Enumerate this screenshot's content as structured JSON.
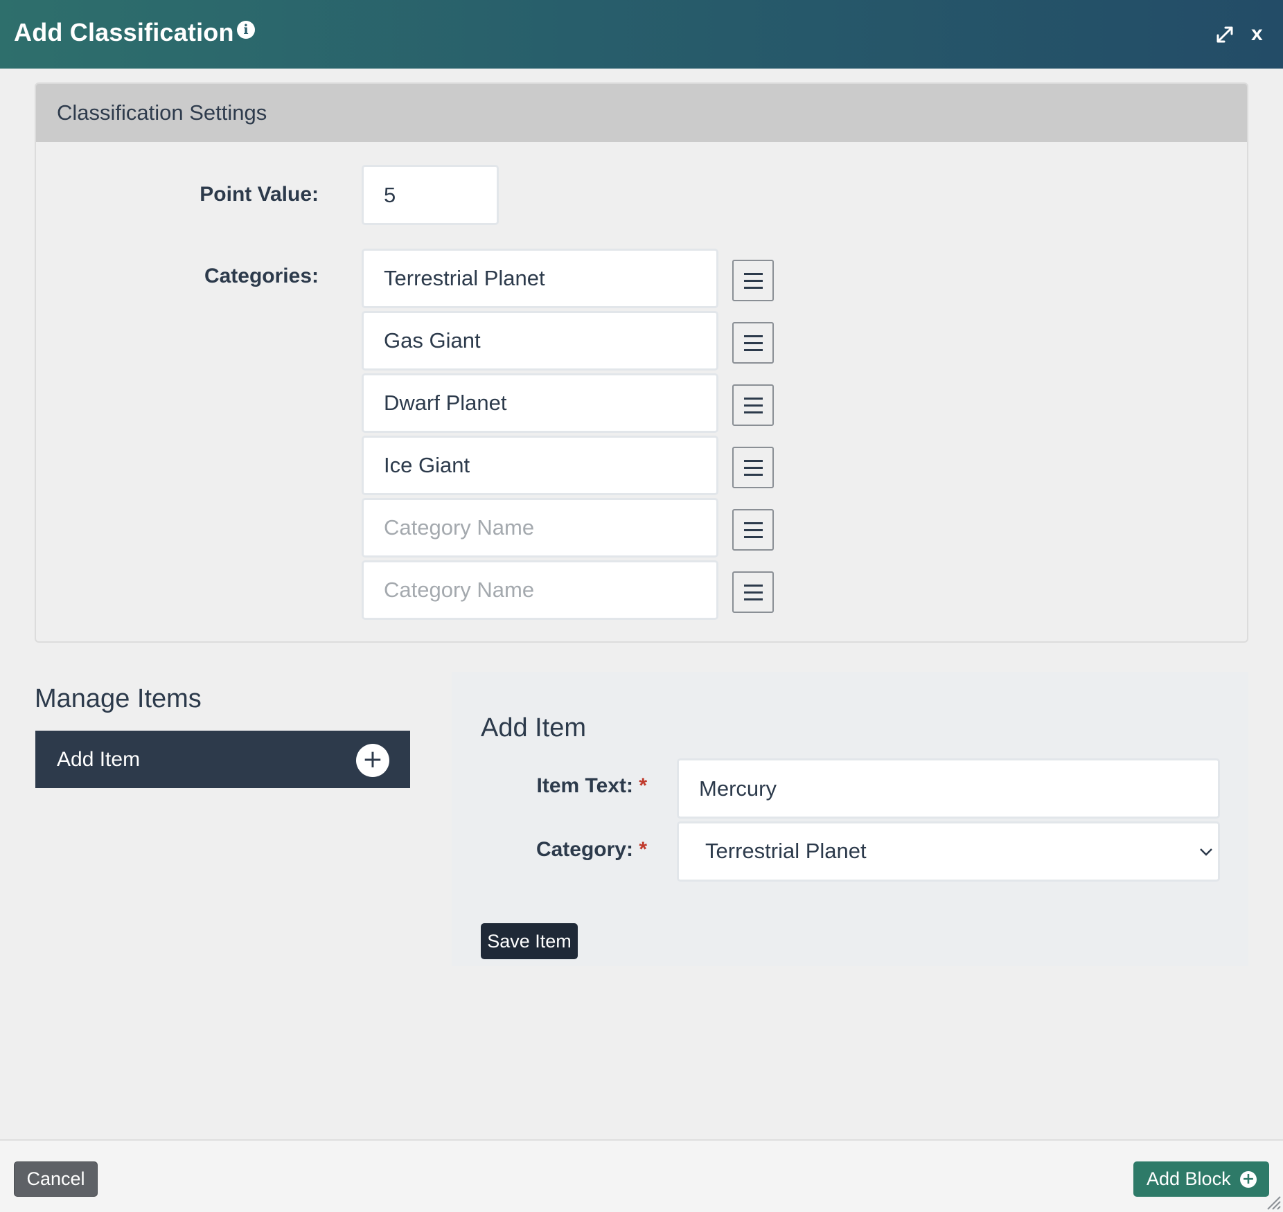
{
  "modal": {
    "title": "Add Classification",
    "info_icon": "info-icon",
    "expand_icon": "expand-icon",
    "close_label": "x"
  },
  "settings": {
    "heading": "Classification Settings",
    "point_value_label": "Point Value:",
    "point_value": "5",
    "categories_label": "Categories:",
    "categories": [
      {
        "value": "Terrestrial Planet",
        "placeholder": "Category Name"
      },
      {
        "value": "Gas Giant",
        "placeholder": "Category Name"
      },
      {
        "value": "Dwarf Planet",
        "placeholder": "Category Name"
      },
      {
        "value": "Ice Giant",
        "placeholder": "Category Name"
      },
      {
        "value": "",
        "placeholder": "Category Name"
      },
      {
        "value": "",
        "placeholder": "Category Name"
      }
    ],
    "drag_icon": "hamburger-icon"
  },
  "manage": {
    "heading": "Manage Items",
    "add_item_label": "Add Item",
    "plus_symbol": "+"
  },
  "item_form": {
    "heading": "Add Item",
    "item_text_label": "Item Text:",
    "item_text_value": "Mercury",
    "category_label": "Category:",
    "category_selected": "Terrestrial Planet",
    "required_mark": "*",
    "save_label": "Save Item"
  },
  "footer": {
    "cancel_label": "Cancel",
    "add_block_label": "Add Block",
    "add_block_symbol": "+"
  },
  "colors": {
    "header_start": "#2e6f6c",
    "header_end": "#234c67",
    "nav_dark": "#2d3a4b",
    "add_block_green": "#2e7a68",
    "required_red": "#c0392b"
  }
}
